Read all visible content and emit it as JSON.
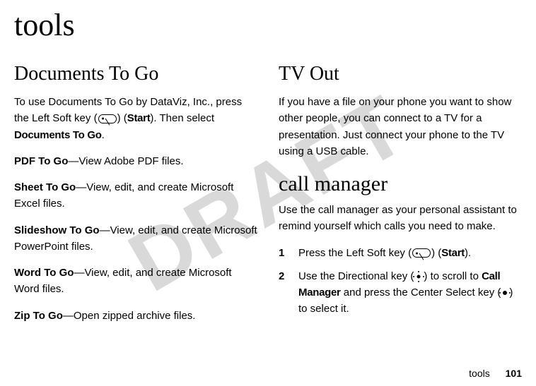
{
  "watermark": "DRAFT",
  "chapter": "tools",
  "left": {
    "heading": "Documents To Go",
    "intro_a": "To use Documents To Go by DataViz, Inc., press the Left Soft key (",
    "intro_b": ") (",
    "intro_start": "Start",
    "intro_c": "). Then select ",
    "intro_sel": "Documents To Go",
    "intro_d": ".",
    "p1_bold": "PDF To Go",
    "p1_rest": "—View Adobe PDF files.",
    "p2_bold": "Sheet To Go",
    "p2_rest": "—View, edit, and create Microsoft Excel files.",
    "p3_bold": "Slideshow To Go",
    "p3_rest": "—View, edit, and create Microsoft PowerPoint files.",
    "p4_bold": "Word To Go",
    "p4_rest": "—View, edit, and create Microsoft Word files.",
    "p5_bold": "Zip To Go",
    "p5_rest": "—Open zipped archive files."
  },
  "right": {
    "heading1": "TV Out",
    "tv_text": "If you have a file on your phone you want to show other people, you can connect to a TV for a presentation. Just connect your phone to the TV using a USB cable.",
    "heading2": "call manager",
    "cm_intro": "Use the call manager as your personal assistant to remind yourself which calls you need to make.",
    "step1_num": "1",
    "step1_a": "Press the Left Soft key (",
    "step1_b": ") (",
    "step1_start": "Start",
    "step1_c": ").",
    "step2_num": "2",
    "step2_a": "Use the Directional key (",
    "step2_b": ") to scroll to ",
    "step2_target": "Call Manager",
    "step2_c": " and press the Center Select key (",
    "step2_d": ") to select it."
  },
  "footer": {
    "section": "tools",
    "page": "101"
  }
}
